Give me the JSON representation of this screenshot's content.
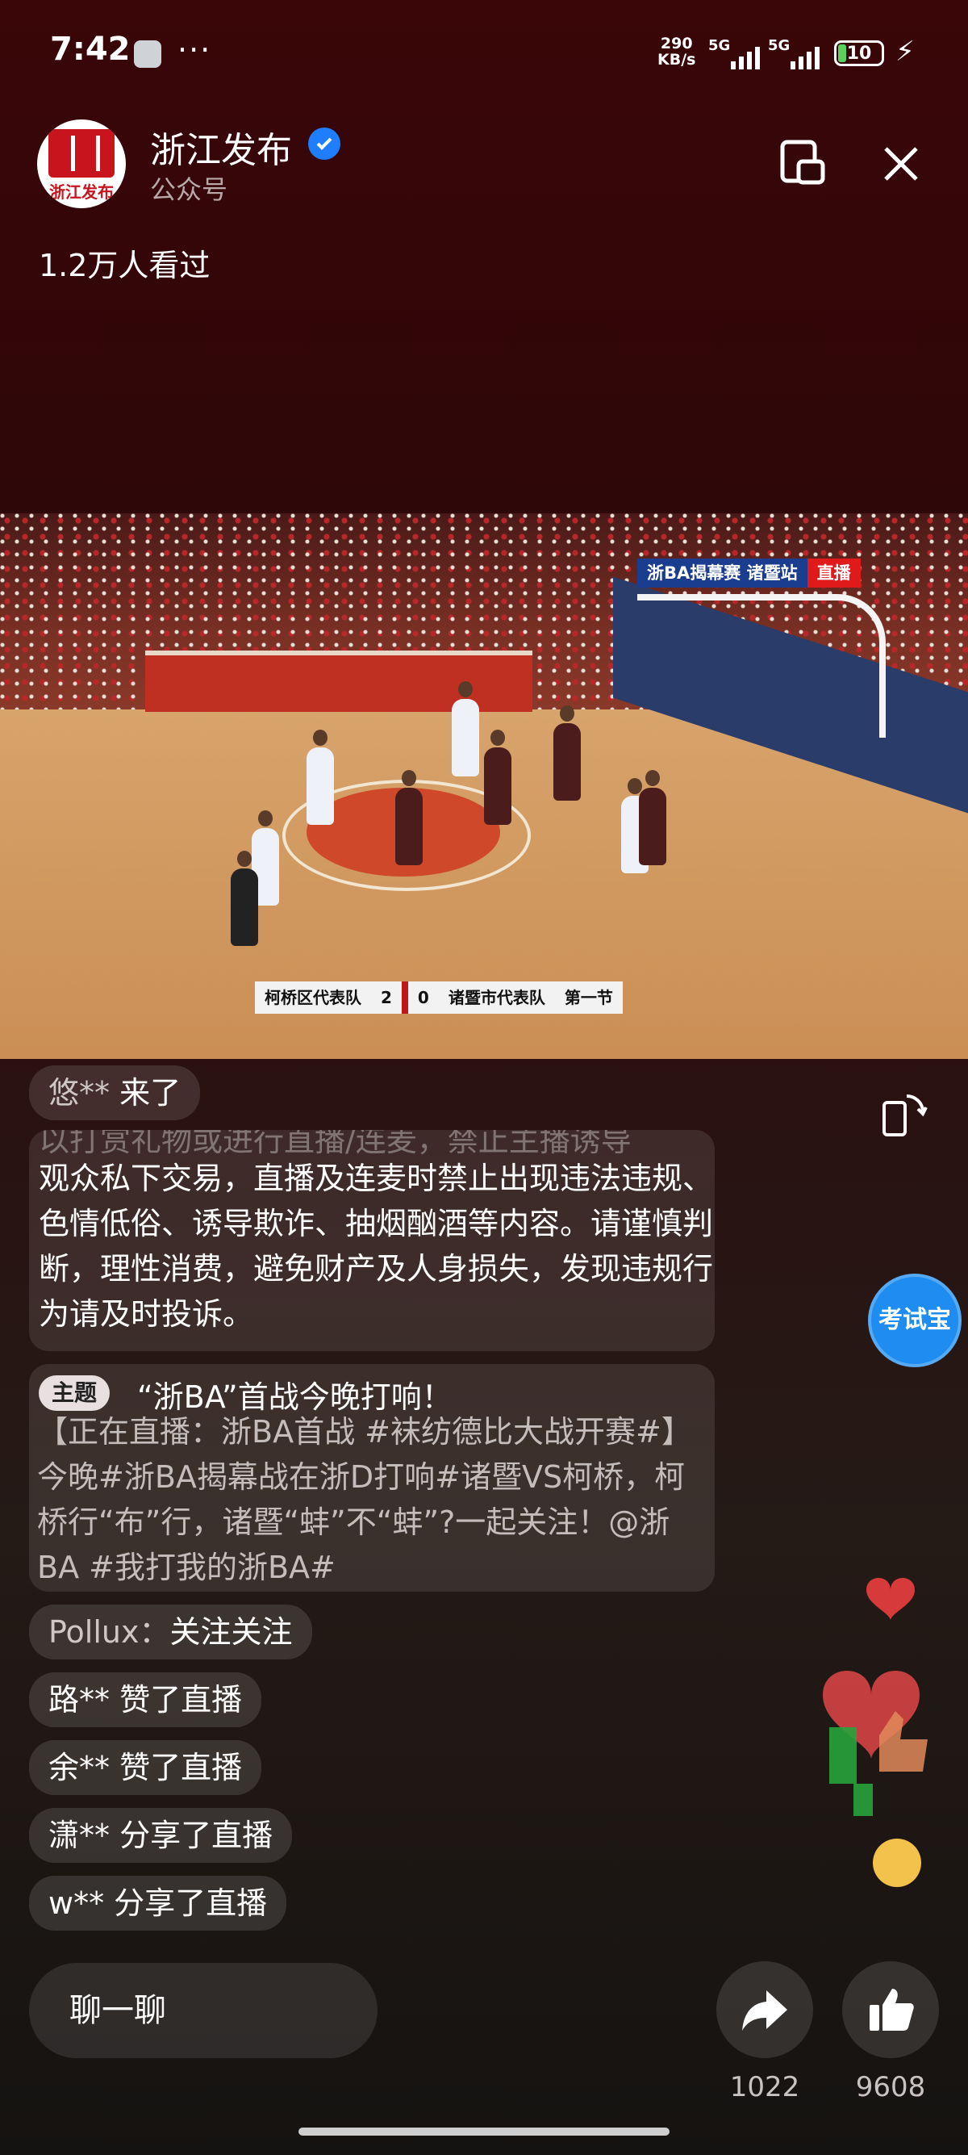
{
  "status": {
    "time": "7:42",
    "dots": "···",
    "net_speed": "290",
    "net_unit": "KB/s",
    "sig1": "5G",
    "sig2": "5G",
    "battery": "10"
  },
  "header": {
    "account_name": "浙江发布",
    "account_type": "公众号",
    "avatar_text": "浙江发布",
    "viewers": "1.2万人看过"
  },
  "video": {
    "live_event": "浙BA揭幕赛  诸暨站",
    "live_label": "直播",
    "team_left": "柯桥区代表队",
    "score_left": "2",
    "score_right": "0",
    "team_right": "诸暨市代表队",
    "period": "第一节"
  },
  "chat": {
    "entry_user": "悠**",
    "entry_action": " 来了",
    "notice_clipped": "以打赏礼物或进行直播/连麦，禁止主播诱导",
    "notice_text": "观众私下交易，直播及连麦时禁止出现违法违规、色情低俗、诱导欺诈、抽烟酗酒等内容。请谨慎判断，理性消费，避免财产及人身损失，发现违规行为请及时投诉。",
    "topic_badge": "主题",
    "topic_title": "“浙BA”首战今晚打响！",
    "topic_body": "【正在直播：浙BA首战 #袜纺德比大战开赛#】今晚#浙BA揭幕战在浙D打响#诸暨VS柯桥，柯桥行“布”行，诸暨“蚌”不“蚌”?一起关注！@浙BA #我打我的浙BA#",
    "messages": [
      {
        "user": "Pollux：",
        "text": "关注关注"
      },
      {
        "user": "路**",
        "text": " 赞了直播"
      },
      {
        "user": "余**",
        "text": " 赞了直播"
      },
      {
        "user": "潇**",
        "text": " 分享了直播"
      },
      {
        "user": "w**",
        "text": " 分享了直播"
      }
    ]
  },
  "side": {
    "kaoshi_label": "考试宝"
  },
  "bottom": {
    "chat_placeholder": "聊一聊",
    "share_count": "1022",
    "like_count": "9608"
  }
}
